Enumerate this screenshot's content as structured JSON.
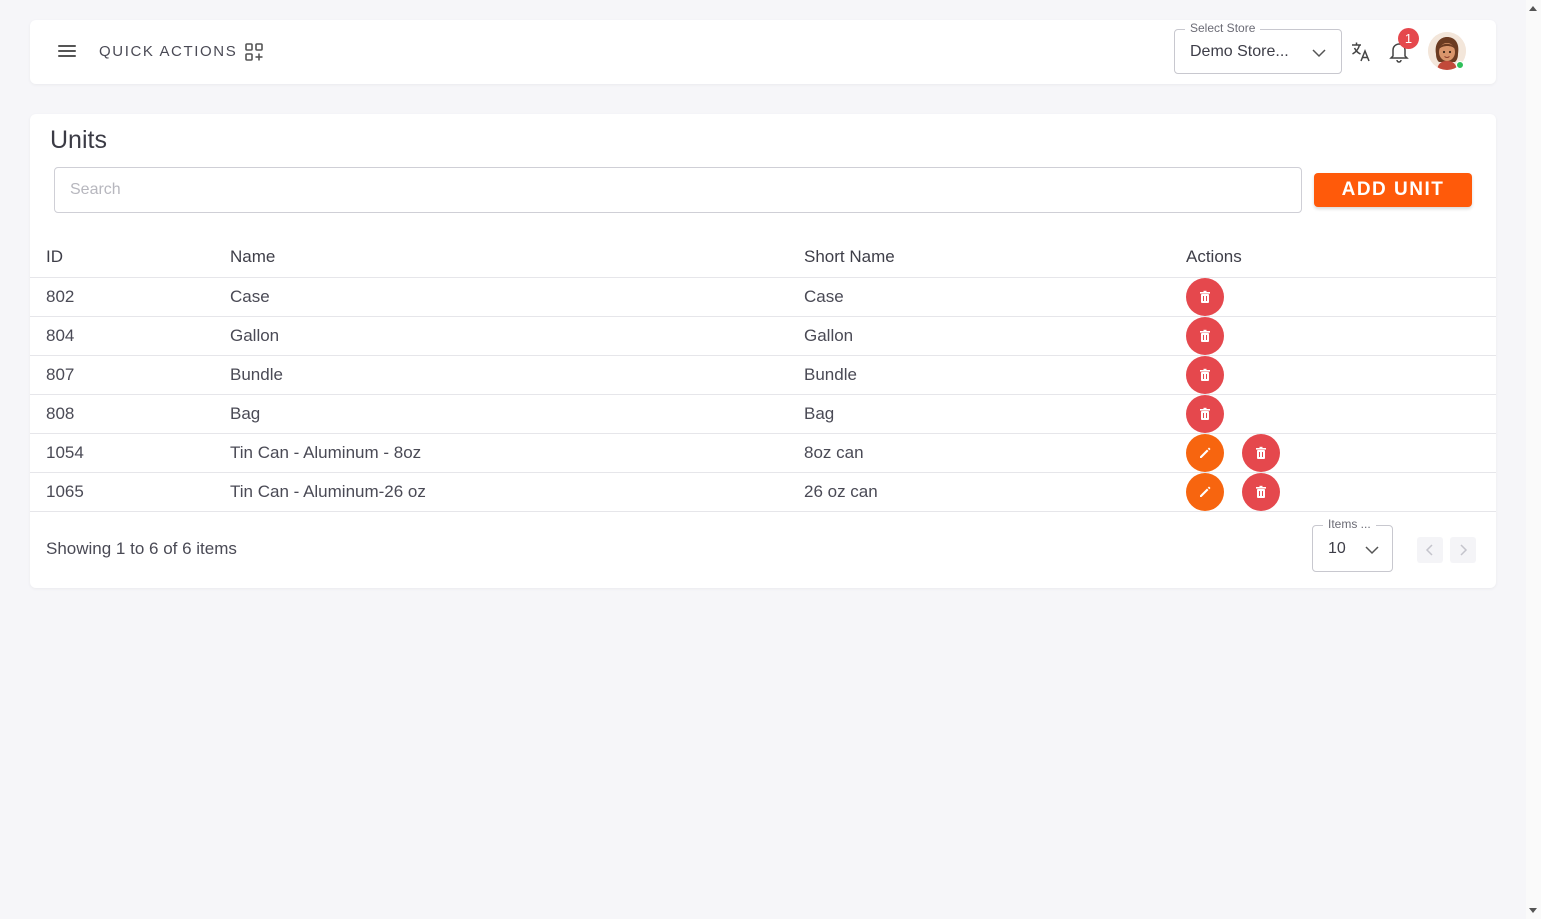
{
  "topbar": {
    "quick_actions_label": "QUICK ACTIONS",
    "store_select_label": "Select Store",
    "store_select_value": "Demo Store...",
    "notification_count": "1"
  },
  "icons": {
    "menu": "hamburger-menu-icon",
    "quick_actions": "grid-plus-icon",
    "translate": "translate-icon",
    "notifications": "bell-icon",
    "edit": "pencil-icon",
    "delete": "trash-icon"
  },
  "colors": {
    "accent": "#ff5a0a",
    "edit": "#f7650f",
    "delete": "#e5484d",
    "online": "#2fbf5a"
  },
  "main": {
    "title": "Units",
    "search_placeholder": "Search",
    "add_button_label": "ADD UNIT",
    "table": {
      "headers": [
        "ID",
        "Name",
        "Short Name",
        "Actions"
      ],
      "rows": [
        {
          "id": "802",
          "name": "Case",
          "short_name": "Case",
          "editable": false
        },
        {
          "id": "804",
          "name": "Gallon",
          "short_name": "Gallon",
          "editable": false
        },
        {
          "id": "807",
          "name": "Bundle",
          "short_name": "Bundle",
          "editable": false
        },
        {
          "id": "808",
          "name": "Bag",
          "short_name": "Bag",
          "editable": false
        },
        {
          "id": "1054",
          "name": "Tin Can - Aluminum - 8oz",
          "short_name": "8oz can",
          "editable": true
        },
        {
          "id": "1065",
          "name": "Tin Can - Aluminum-26 oz",
          "short_name": "26 oz can",
          "editable": true
        }
      ]
    },
    "footer": {
      "showing_text": "Showing 1 to 6 of 6 items",
      "items_label": "Items ...",
      "items_value": "10"
    }
  }
}
